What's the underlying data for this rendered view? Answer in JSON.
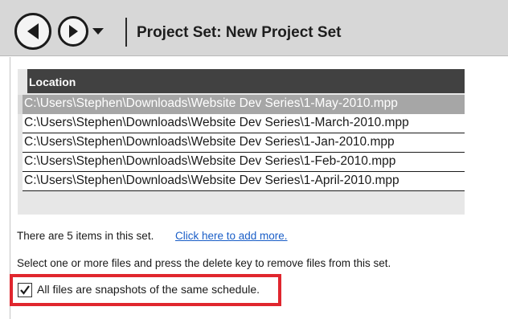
{
  "header": {
    "title": "Project Set: New Project Set"
  },
  "table": {
    "column_header": "Location",
    "rows": [
      {
        "path": "C:\\Users\\Stephen\\Downloads\\Website Dev Series\\1-May-2010.mpp",
        "selected": true
      },
      {
        "path": "C:\\Users\\Stephen\\Downloads\\Website Dev Series\\1-March-2010.mpp",
        "selected": false
      },
      {
        "path": "C:\\Users\\Stephen\\Downloads\\Website Dev Series\\1-Jan-2010.mpp",
        "selected": false
      },
      {
        "path": "C:\\Users\\Stephen\\Downloads\\Website Dev Series\\1-Feb-2010.mpp",
        "selected": false
      },
      {
        "path": "C:\\Users\\Stephen\\Downloads\\Website Dev Series\\1-April-2010.mpp",
        "selected": false
      }
    ]
  },
  "info": {
    "count_text": "There are 5 items in this set.",
    "add_link": "Click here to add more.",
    "hint": "Select one or more files and press the delete key to remove files from this set."
  },
  "snapshot_option": {
    "label": "All files are snapshots of the same schedule.",
    "checked": true
  },
  "colors": {
    "header_bg": "#d7d7d7",
    "column_header_bg": "#414141",
    "selected_row_bg": "#a6a6a6",
    "link": "#1a5ec7",
    "highlight_border": "#e0262e"
  },
  "icons": {
    "back": "back-arrow-circle-icon",
    "forward": "forward-arrow-circle-icon",
    "dropdown": "chevron-down-icon",
    "check": "checkmark-icon"
  }
}
